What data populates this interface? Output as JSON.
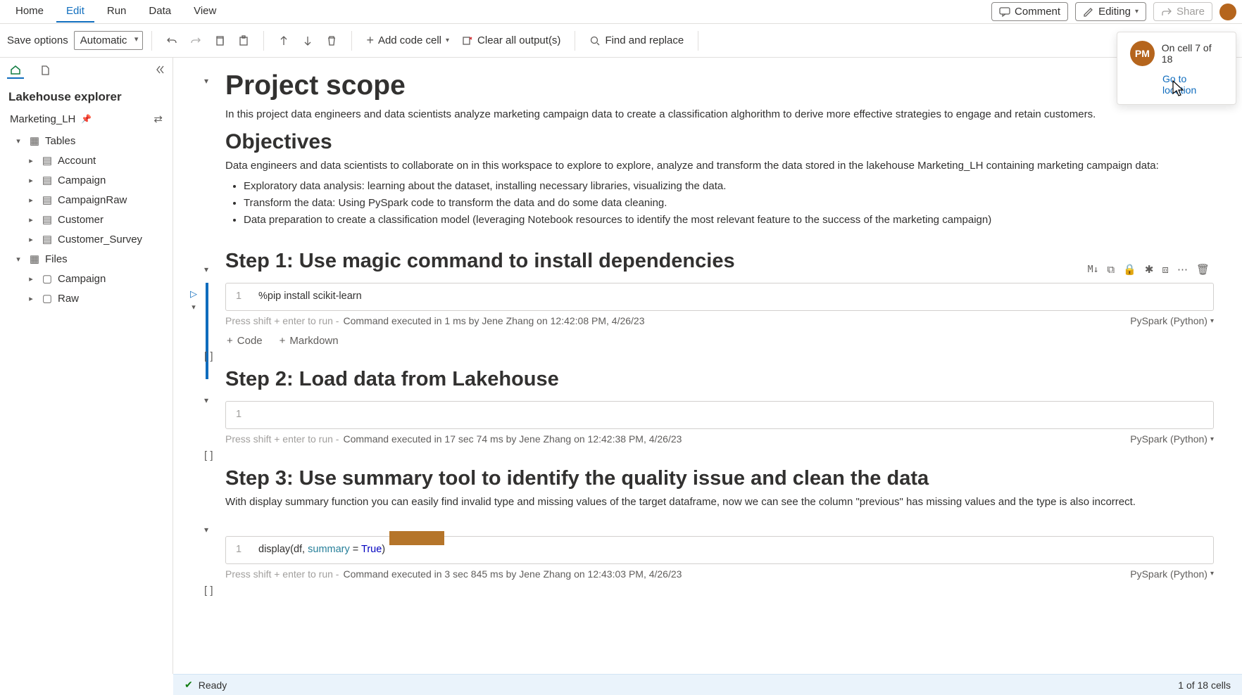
{
  "menu": {
    "home": "Home",
    "edit": "Edit",
    "run": "Run",
    "data": "Data",
    "view": "View",
    "comment": "Comment",
    "editing": "Editing",
    "share": "Share"
  },
  "toolbar": {
    "save_label": "Save options",
    "save_mode": "Automatic",
    "add_code": "Add code cell",
    "clear_output": "Clear all output(s)",
    "find_replace": "Find and replace"
  },
  "sidebar": {
    "title": "Lakehouse explorer",
    "lakehouse": "Marketing_LH",
    "tables_label": "Tables",
    "files_label": "Files",
    "tables": [
      "Account",
      "Campaign",
      "CampaignRaw",
      "Customer",
      "Customer_Survey"
    ],
    "files": [
      "Campaign",
      "Raw"
    ]
  },
  "doc": {
    "scope_title": "Project scope",
    "scope_para": "In this project data engineers and data scientists analyze marketing campaign data to create a classification alghorithm to derive more effective strategies to engage and retain customers.",
    "objectives_title": "Objectives",
    "objectives_para": "Data engineers and data scientists to collaborate on in this workspace to explore to explore, analyze and transform the data stored in the lakehouse Marketing_LH containing marketing campaign data:",
    "bullets": [
      "Exploratory data analysis: learning about the dataset, installing necessary libraries, visualizing the data.",
      "Transform the data: Using PySpark code to transform the data and do some data cleaning.",
      "Data preparation to create a classification model (leveraging Notebook resources to identify the most relevant feature to the success of the marketing campaign)"
    ],
    "step1_title": "Step 1: Use magic command to install dependencies",
    "step2_title": "Step 2: Load data from Lakehouse",
    "step3_title": "Step 3: Use summary tool to identify the quality issue and clean the data",
    "step3_para": "With display summary function you can easily find invalid type and missing values of the target dataframe, now we can see the column \"previous\" has missing values and the type is also incorrect."
  },
  "cells": {
    "c1_code": "%pip install scikit-learn",
    "c1_status": "Command executed in 1 ms by Jene Zhang on 12:42:08 PM, 4/26/23",
    "c2_status": "Command executed in 17 sec 74 ms by Jene Zhang on 12:42:38 PM, 4/26/23",
    "c3_code_pre": "display(df, ",
    "c3_code_kw": "summary",
    "c3_code_mid": " = ",
    "c3_code_bool": "True",
    "c3_code_post": ")",
    "c3_status": "Command executed in 3 sec 845 ms by Jene Zhang on 12:43:03 PM, 4/26/23",
    "run_hint": "Press shift + enter to run - ",
    "kernel": "PySpark (Python)",
    "line1": "1",
    "add_code": "Code",
    "add_md": "Markdown",
    "md_badge": "M↓"
  },
  "presence": {
    "initials": "PM",
    "status": "On cell 7 of 18",
    "link": "Go to location"
  },
  "status": {
    "ready": "Ready",
    "count": "1 of 18 cells"
  }
}
